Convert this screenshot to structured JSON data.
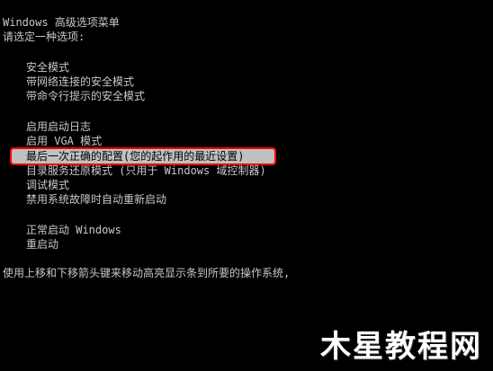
{
  "header": {
    "title": "Windows 高级选项菜单",
    "prompt": "请选定一种选项:"
  },
  "menu": {
    "groups": [
      {
        "items": [
          {
            "label": "安全模式"
          },
          {
            "label": "带网络连接的安全模式"
          },
          {
            "label": "带命令行提示的安全模式"
          }
        ]
      },
      {
        "items": [
          {
            "label": "启用启动日志"
          },
          {
            "label": "启用 VGA 模式"
          },
          {
            "label": "最后一次正确的配置(您的起作用的最近设置)",
            "selected": true
          },
          {
            "label": "目录服务还原模式 (只用于 Windows 域控制器)"
          },
          {
            "label": "调试模式"
          },
          {
            "label": "禁用系统故障时自动重新启动"
          }
        ]
      },
      {
        "items": [
          {
            "label": "正常启动 Windows"
          },
          {
            "label": "重启动"
          }
        ]
      }
    ]
  },
  "footer": {
    "hint": "使用上移和下移箭头键来移动高亮显示条到所要的操作系统,"
  },
  "watermark": {
    "text": "木星教程网"
  },
  "colors": {
    "background": "#000000",
    "text": "#c8c8c8",
    "highlight_bg": "#c0c0c0",
    "highlight_text": "#000000",
    "selection_outline": "#ff0000"
  }
}
